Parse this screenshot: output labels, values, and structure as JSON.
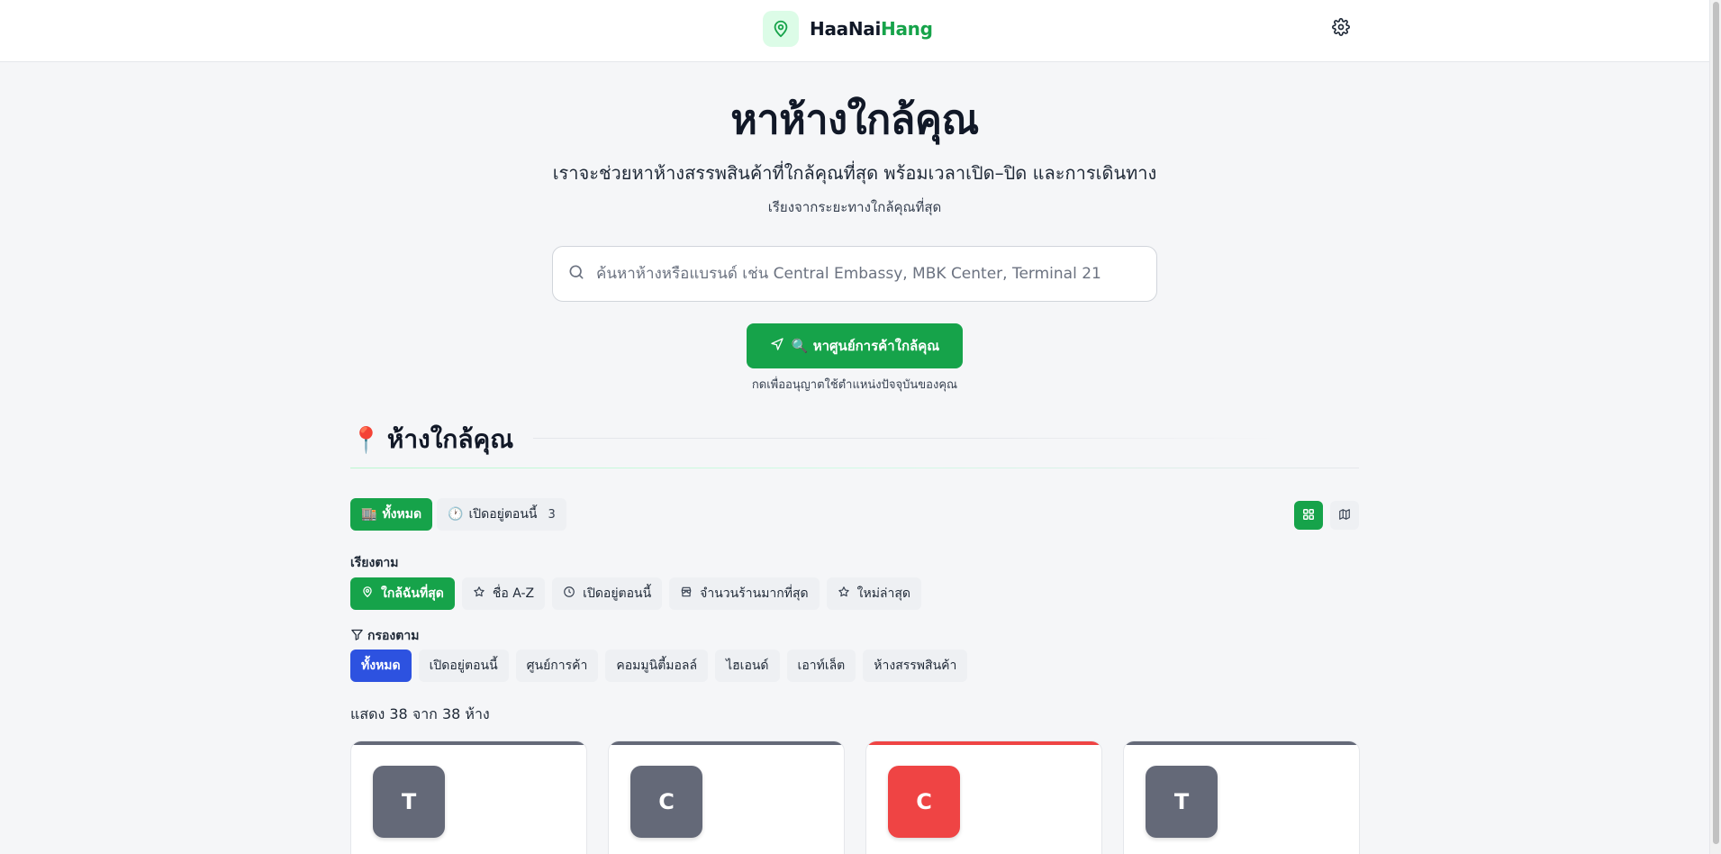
{
  "brand": {
    "name_part1": "HaaNai",
    "name_part2": "Hang",
    "accent": "#16a34a"
  },
  "header": {
    "settings_icon": "gear-icon"
  },
  "hero": {
    "title": "หาห้างใกล้คุณ",
    "subtitle": "เราจะช่วยหาห้างสรรพสินค้าที่ใกล้คุณที่สุด พร้อมเวลาเปิด–ปิด และการเดินทาง",
    "note": "เรียงจากระยะทางใกล้คุณที่สุด"
  },
  "search": {
    "placeholder": "ค้นหาห้างหรือแบรนด์ เช่น Central Embassy, MBK Center, Terminal 21",
    "value": ""
  },
  "locate": {
    "label": "🔍 หาศูนย์การค้าใกล้คุณ",
    "hint": "กดเพื่ออนุญาตใช้ตำแหน่งปัจจุบันของคุณ"
  },
  "section": {
    "icon": "📍",
    "title": "ห้างใกล้คุณ"
  },
  "tabs": {
    "all": {
      "icon": "🏬",
      "label": "ทั้งหมด"
    },
    "open": {
      "icon": "🕐",
      "label": "เปิดอยู่ตอนนี้",
      "count": "3"
    }
  },
  "sort": {
    "label": "เรียงตาม",
    "options": [
      {
        "label": "ใกล้ฉันที่สุด",
        "icon": "map-pin-icon"
      },
      {
        "label": "ชื่อ A-Z",
        "icon": "star-icon"
      },
      {
        "label": "เปิดอยู่ตอนนี้",
        "icon": "clock-icon"
      },
      {
        "label": "จำนวนร้านมากที่สุด",
        "icon": "store-icon"
      },
      {
        "label": "ใหม่ล่าสุด",
        "icon": "star-icon"
      }
    ]
  },
  "filter": {
    "label": "กรองตาม",
    "options": [
      "ทั้งหมด",
      "เปิดอยู่ตอนนี้",
      "ศูนย์การค้า",
      "คอมมูนิตี้มอลล์",
      "ไฮเอนด์",
      "เอาท์เล็ต",
      "ห้างสรรพสินค้า"
    ]
  },
  "results": {
    "text": "แสดง 38 จาก 38 ห้าง"
  },
  "cards": [
    {
      "initial": "T",
      "color": "#646978"
    },
    {
      "initial": "C",
      "color": "#646978"
    },
    {
      "initial": "C",
      "color": "#ef4444"
    },
    {
      "initial": "T",
      "color": "#646978"
    }
  ]
}
